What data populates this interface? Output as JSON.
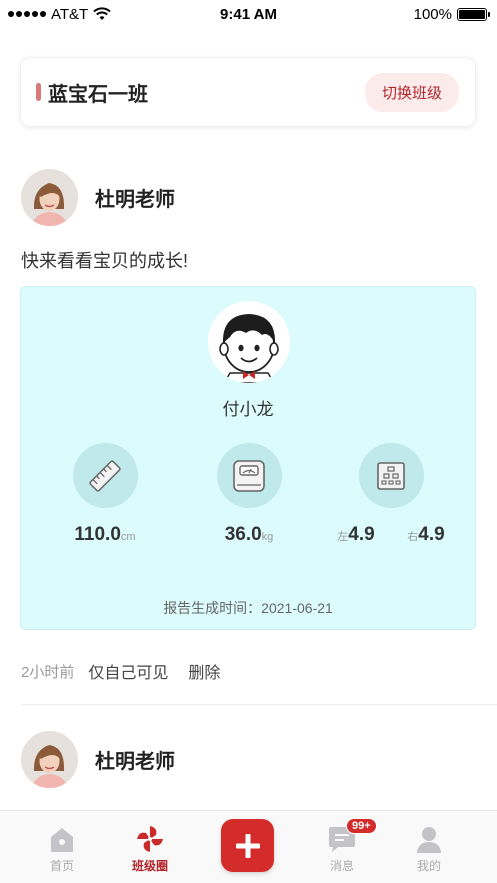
{
  "status_bar": {
    "carrier": "AT&T",
    "time": "9:41 AM",
    "battery_percent": "100%",
    "battery_level": 1.0
  },
  "class_header": {
    "title": "蓝宝石一班",
    "switch_label": "切换班级",
    "accent_color": "#d9797a"
  },
  "posts": [
    {
      "teacher_name": "杜明老师",
      "text": "快来看看宝贝的成长!",
      "report": {
        "child_name": "付小龙",
        "height_value": "110.0",
        "height_unit": "cm",
        "weight_value": "36.0",
        "weight_unit": "kg",
        "vision_left_label": "左",
        "vision_left_value": "4.9",
        "vision_right_label": "右",
        "vision_right_value": "4.9",
        "generated_time": "报告生成时间：2021-06-21"
      },
      "time_ago": "2小时前",
      "visibility": "仅自己可见",
      "delete_label": "删除"
    },
    {
      "teacher_name": "杜明老师"
    }
  ],
  "tab_bar": {
    "tabs": [
      {
        "label": "首页",
        "icon": "home-icon"
      },
      {
        "label": "班级圈",
        "icon": "pinwheel-icon"
      },
      {
        "label": "",
        "icon": "plus-icon"
      },
      {
        "label": "消息",
        "icon": "message-icon",
        "badge": "99+"
      },
      {
        "label": "我的",
        "icon": "user-icon"
      }
    ],
    "active_color": "#b3252a"
  }
}
